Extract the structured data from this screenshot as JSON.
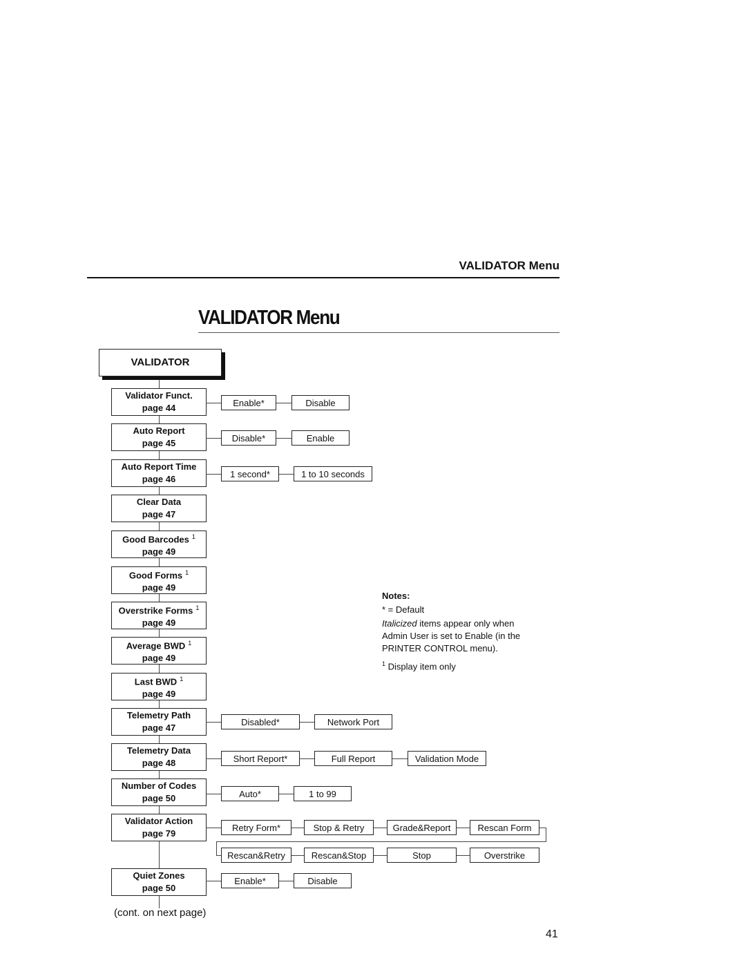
{
  "header": {
    "running_title": "VALIDATOR Menu"
  },
  "title": "VALIDATOR Menu",
  "diagram": {
    "root": "VALIDATOR",
    "items": [
      {
        "name": "Validator Funct.",
        "page": "page 44",
        "options": [
          [
            "Enable*",
            "Disable"
          ]
        ]
      },
      {
        "name": "Auto Report",
        "page": "page 45",
        "options": [
          [
            "Disable*",
            "Enable"
          ]
        ]
      },
      {
        "name": "Auto Report Time",
        "page": "page 46",
        "options": [
          [
            "1 second*",
            "1 to 10 seconds"
          ]
        ]
      },
      {
        "name": "Clear Data",
        "page": "page 47",
        "options": []
      },
      {
        "name": "Good Barcodes",
        "note": "1",
        "page": "page 49",
        "options": []
      },
      {
        "name": "Good Forms",
        "note": "1",
        "page": "page 49",
        "options": []
      },
      {
        "name": "Overstrike Forms",
        "note": "1",
        "page": "page 49",
        "options": []
      },
      {
        "name": "Average BWD",
        "note": "1",
        "page": "page 49",
        "options": []
      },
      {
        "name": "Last BWD",
        "note": "1",
        "page": "page 49",
        "options": []
      },
      {
        "name": "Telemetry Path",
        "page": "page 47",
        "options": [
          [
            "Disabled*",
            "Network Port"
          ]
        ]
      },
      {
        "name": "Telemetry Data",
        "page": "page 48",
        "options": [
          [
            "Short Report*",
            "Full Report",
            "Validation Mode"
          ]
        ]
      },
      {
        "name": "Number of Codes",
        "page": "page 50",
        "options": [
          [
            "Auto*",
            "1 to 99"
          ]
        ]
      },
      {
        "name": "Validator Action",
        "page": "page 79",
        "options": [
          [
            "Retry Form*",
            "Stop & Retry",
            "Grade&Report",
            "Rescan Form"
          ],
          [
            "Rescan&Retry",
            "Rescan&Stop",
            "Stop",
            "Overstrike"
          ]
        ]
      },
      {
        "name": "Quiet Zones",
        "page": "page 50",
        "options": [
          [
            "Enable*",
            "Disable"
          ]
        ]
      }
    ],
    "continuation": "(cont. on next page)"
  },
  "notes": {
    "heading": "Notes:",
    "default": "* = Default",
    "italic_word": "Italicized",
    "italic_rest": " items appear only when Admin User is set to Enable (in the PRINTER CONTROL menu).",
    "footnote_mark": "1",
    "footnote": " Display item only"
  },
  "page_number": "41"
}
